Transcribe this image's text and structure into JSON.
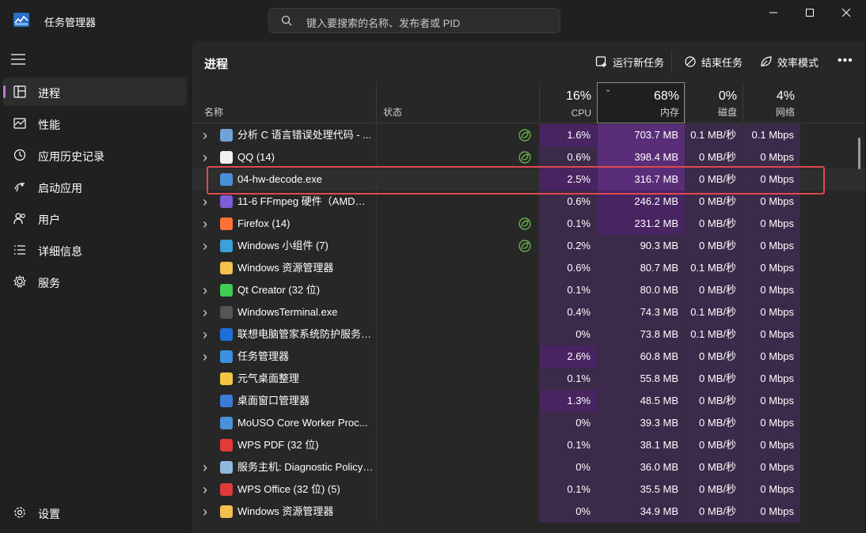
{
  "app": {
    "title": "任务管理器",
    "search_placeholder": "键入要搜索的名称、发布者或 PID"
  },
  "sidebar": {
    "items": [
      {
        "label": "进程",
        "icon": "processes-icon",
        "active": true
      },
      {
        "label": "性能",
        "icon": "performance-icon"
      },
      {
        "label": "应用历史记录",
        "icon": "app-history-icon"
      },
      {
        "label": "启动应用",
        "icon": "startup-icon"
      },
      {
        "label": "用户",
        "icon": "users-icon"
      },
      {
        "label": "详细信息",
        "icon": "details-icon"
      },
      {
        "label": "服务",
        "icon": "services-icon"
      }
    ],
    "settings_label": "设置"
  },
  "main": {
    "title": "进程",
    "toolbar": {
      "run_new_task": "运行新任务",
      "end_task": "结束任务",
      "efficiency_mode": "效率模式"
    }
  },
  "columns": {
    "name": "名称",
    "status": "状态",
    "cpu": {
      "pct": "16%",
      "label": "CPU"
    },
    "memory": {
      "pct": "68%",
      "label": "内存"
    },
    "disk": {
      "pct": "0%",
      "label": "磁盘"
    },
    "network": {
      "pct": "4%",
      "label": "网络"
    }
  },
  "colors": {
    "accent": "#c074d9",
    "heat_strong": "#5a2d78",
    "heat_medium": "#482461",
    "heat_light": "#3b2a4a",
    "highlight_border": "#e0484f"
  },
  "processes": [
    {
      "name": "分析 C 语言错误处理代码 - ...",
      "expand": true,
      "icon": "avatar-icon",
      "iconColor": "#6fa3d8",
      "eco": true,
      "cpu": "1.6%",
      "mem": "703.7 MB",
      "disk": "0.1 MB/秒",
      "net": "0.1 Mbps",
      "heat": [
        "medium",
        "strong",
        "light",
        "light"
      ]
    },
    {
      "name": "QQ (14)",
      "expand": true,
      "icon": "qq-icon",
      "iconColor": "#f0f0f0",
      "eco": true,
      "cpu": "0.6%",
      "mem": "398.4 MB",
      "disk": "0 MB/秒",
      "net": "0 Mbps",
      "heat": [
        "light",
        "strong",
        "light",
        "light"
      ]
    },
    {
      "name": "04-hw-decode.exe",
      "expand": false,
      "icon": "app-window-icon",
      "iconColor": "#4a90d9",
      "eco": false,
      "cpu": "2.5%",
      "mem": "316.7 MB",
      "disk": "0 MB/秒",
      "net": "0 Mbps",
      "heat": [
        "medium",
        "strong",
        "light",
        "light"
      ],
      "selected": true
    },
    {
      "name": "11-6 FFmpeg 硬件（AMD）...",
      "expand": true,
      "icon": "app-purple-icon",
      "iconColor": "#7c5cd8",
      "eco": false,
      "cpu": "0.6%",
      "mem": "246.2 MB",
      "disk": "0 MB/秒",
      "net": "0 Mbps",
      "heat": [
        "light",
        "medium",
        "light",
        "light"
      ]
    },
    {
      "name": "Firefox (14)",
      "expand": true,
      "icon": "firefox-icon",
      "iconColor": "#ff7139",
      "eco": true,
      "cpu": "0.1%",
      "mem": "231.2 MB",
      "disk": "0 MB/秒",
      "net": "0 Mbps",
      "heat": [
        "light",
        "medium",
        "light",
        "light"
      ]
    },
    {
      "name": "Windows 小组件 (7)",
      "expand": true,
      "icon": "widgets-icon",
      "iconColor": "#3aa0d8",
      "eco": true,
      "cpu": "0.2%",
      "mem": "90.3 MB",
      "disk": "0 MB/秒",
      "net": "0 Mbps",
      "heat": [
        "light",
        "light",
        "light",
        "light"
      ]
    },
    {
      "name": "Windows 资源管理器",
      "expand": false,
      "icon": "folder-icon",
      "iconColor": "#f2c14e",
      "eco": false,
      "cpu": "0.6%",
      "mem": "80.7 MB",
      "disk": "0.1 MB/秒",
      "net": "0 Mbps",
      "heat": [
        "light",
        "light",
        "light",
        "light"
      ]
    },
    {
      "name": "Qt Creator (32 位)",
      "expand": true,
      "icon": "qt-icon",
      "iconColor": "#41cd52",
      "eco": false,
      "cpu": "0.1%",
      "mem": "80.0 MB",
      "disk": "0 MB/秒",
      "net": "0 Mbps",
      "heat": [
        "light",
        "light",
        "light",
        "light"
      ]
    },
    {
      "name": "WindowsTerminal.exe",
      "expand": true,
      "icon": "terminal-icon",
      "iconColor": "#555555",
      "eco": false,
      "cpu": "0.4%",
      "mem": "74.3 MB",
      "disk": "0.1 MB/秒",
      "net": "0 Mbps",
      "heat": [
        "light",
        "light",
        "light",
        "light"
      ]
    },
    {
      "name": "联想电脑管家系统防护服务 (3...",
      "expand": true,
      "icon": "shield-icon",
      "iconColor": "#1e6fd9",
      "eco": false,
      "cpu": "0%",
      "mem": "73.8 MB",
      "disk": "0.1 MB/秒",
      "net": "0 Mbps",
      "heat": [
        "light",
        "light",
        "light",
        "light"
      ]
    },
    {
      "name": "任务管理器",
      "expand": true,
      "icon": "taskmgr-icon",
      "iconColor": "#3d8fe0",
      "eco": false,
      "cpu": "2.6%",
      "mem": "60.8 MB",
      "disk": "0 MB/秒",
      "net": "0 Mbps",
      "heat": [
        "medium",
        "light",
        "light",
        "light"
      ]
    },
    {
      "name": "元气桌面整理",
      "expand": false,
      "icon": "yuanqi-icon",
      "iconColor": "#f5c542",
      "eco": false,
      "cpu": "0.1%",
      "mem": "55.8 MB",
      "disk": "0 MB/秒",
      "net": "0 Mbps",
      "heat": [
        "light",
        "light",
        "light",
        "light"
      ]
    },
    {
      "name": "桌面窗口管理器",
      "expand": false,
      "icon": "dwm-icon",
      "iconColor": "#3a7bd5",
      "eco": false,
      "cpu": "1.3%",
      "mem": "48.5 MB",
      "disk": "0 MB/秒",
      "net": "0 Mbps",
      "heat": [
        "medium",
        "light",
        "light",
        "light"
      ]
    },
    {
      "name": "MoUSO Core Worker Proc...",
      "expand": false,
      "icon": "app-window-icon",
      "iconColor": "#4a90d9",
      "eco": false,
      "cpu": "0%",
      "mem": "39.3 MB",
      "disk": "0 MB/秒",
      "net": "0 Mbps",
      "heat": [
        "light",
        "light",
        "light",
        "light"
      ]
    },
    {
      "name": "WPS PDF (32 位)",
      "expand": false,
      "icon": "wps-pdf-icon",
      "iconColor": "#e03a3a",
      "eco": false,
      "cpu": "0.1%",
      "mem": "38.1 MB",
      "disk": "0 MB/秒",
      "net": "0 Mbps",
      "heat": [
        "light",
        "light",
        "light",
        "light"
      ]
    },
    {
      "name": "服务主机: Diagnostic Policy ...",
      "expand": true,
      "icon": "gear-service-icon",
      "iconColor": "#8fb8de",
      "eco": false,
      "cpu": "0%",
      "mem": "36.0 MB",
      "disk": "0 MB/秒",
      "net": "0 Mbps",
      "heat": [
        "light",
        "light",
        "light",
        "light"
      ]
    },
    {
      "name": "WPS Office (32 位) (5)",
      "expand": true,
      "icon": "wps-icon",
      "iconColor": "#e03a3a",
      "eco": false,
      "cpu": "0.1%",
      "mem": "35.5 MB",
      "disk": "0 MB/秒",
      "net": "0 Mbps",
      "heat": [
        "light",
        "light",
        "light",
        "light"
      ]
    },
    {
      "name": "Windows 资源管理器",
      "expand": true,
      "icon": "folder-icon",
      "iconColor": "#f2c14e",
      "eco": false,
      "cpu": "0%",
      "mem": "34.9 MB",
      "disk": "0 MB/秒",
      "net": "0 Mbps",
      "heat": [
        "light",
        "light",
        "light",
        "light"
      ]
    }
  ]
}
